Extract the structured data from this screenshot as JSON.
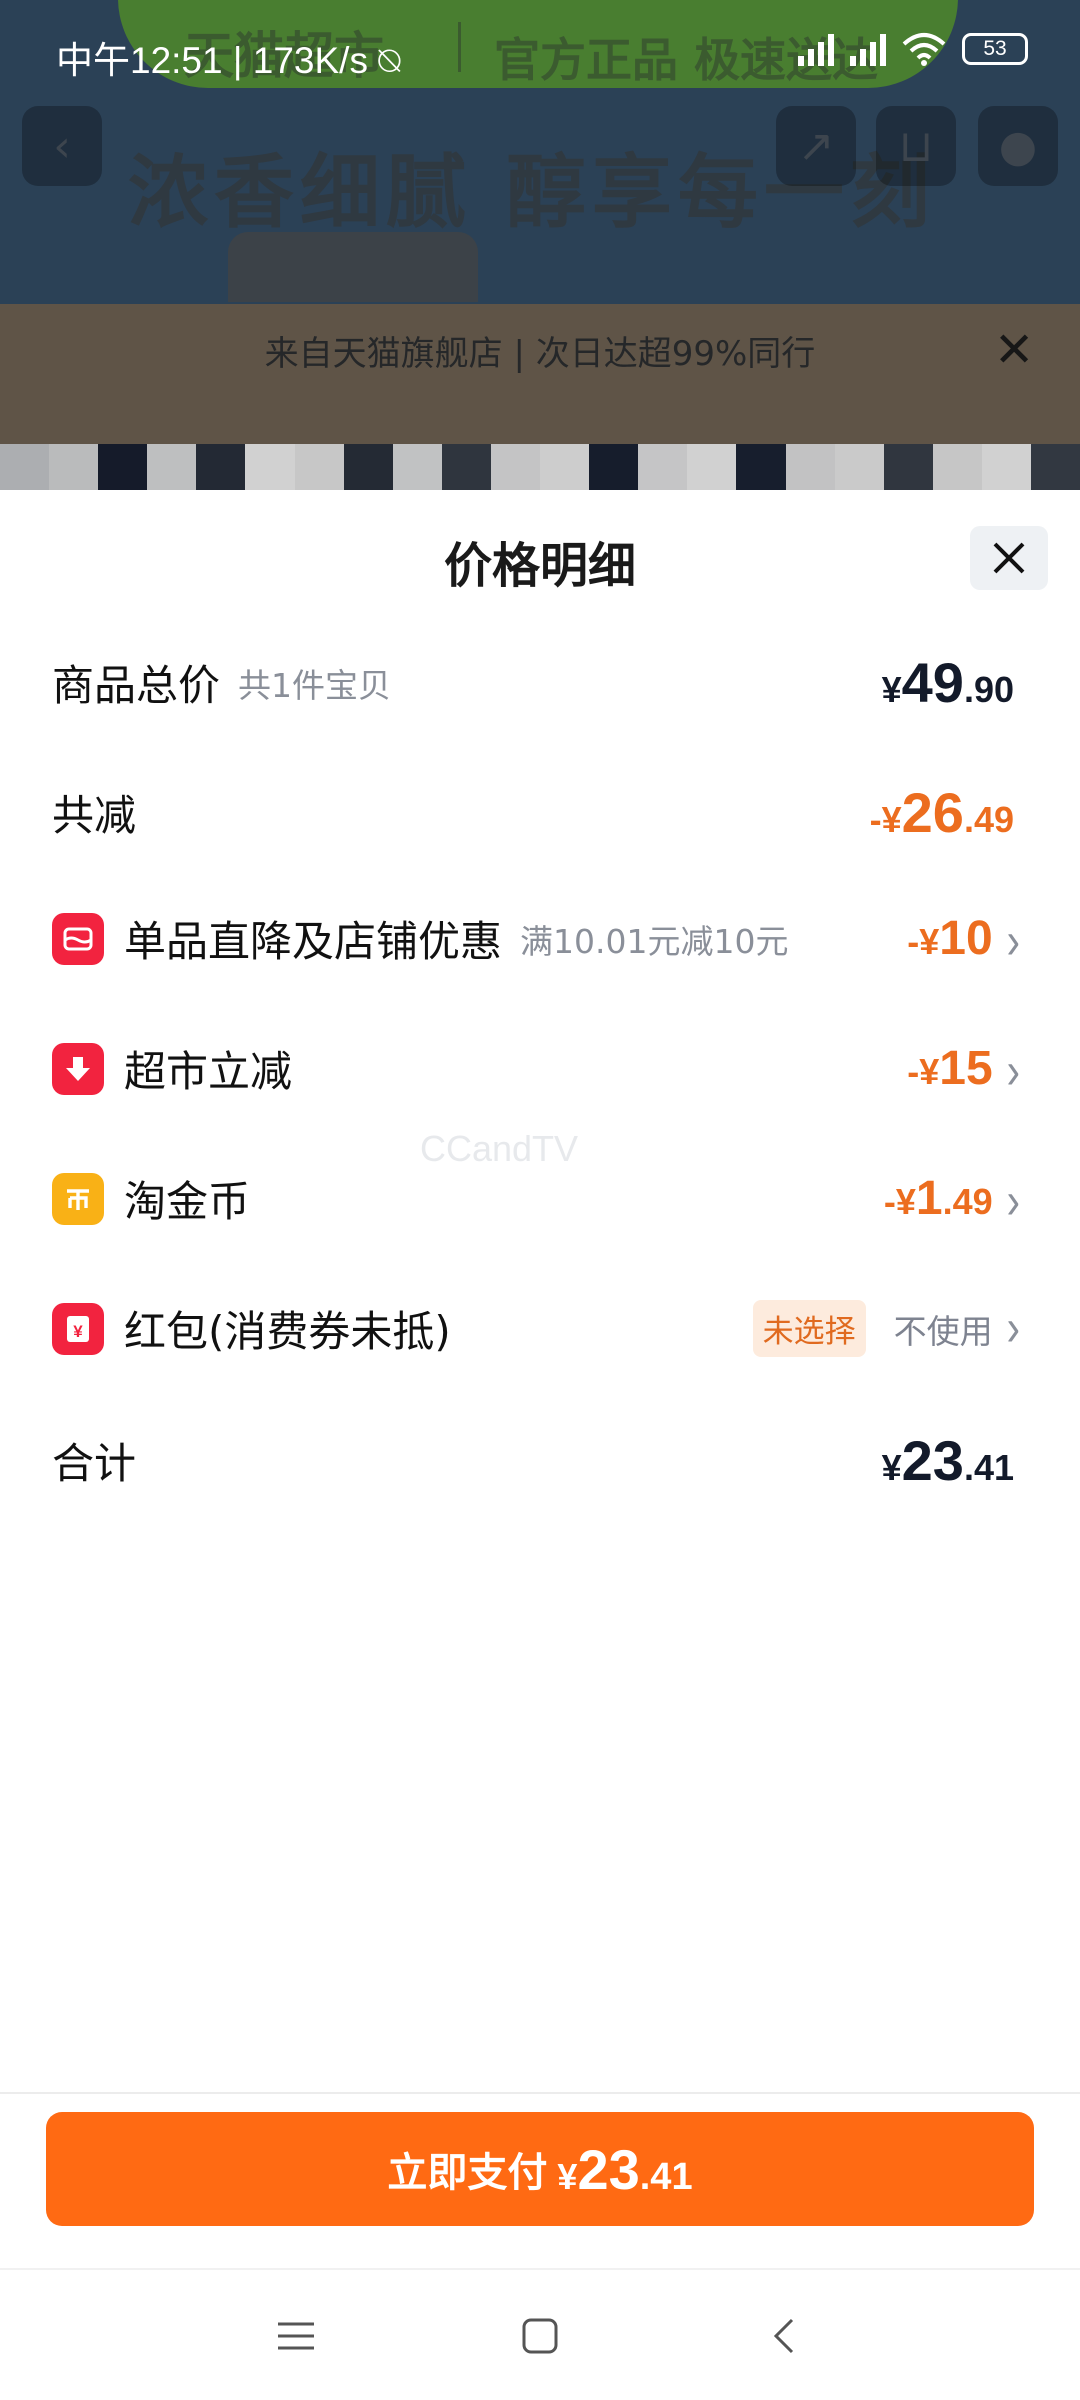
{
  "status_bar": {
    "time": "中午12:51",
    "speed": "173K/s",
    "battery": "53"
  },
  "background_page": {
    "banner_store": "天猫超市",
    "banner_tag": "官方正品 极速送达",
    "slogan": "浓香细腻 醇享每一刻",
    "strip_text": "来自天猫旗舰店 | 次日达超99%同行"
  },
  "sheet": {
    "title": "价格明细",
    "rows": {
      "total_label": "商品总价",
      "total_sub": "共1件宝贝",
      "total_price": {
        "cur": "¥",
        "int": "49",
        "dec": ".90"
      },
      "discount_label": "共减",
      "discount_price": {
        "cur": "-¥",
        "int": "26",
        "dec": ".49"
      },
      "item1_label": "单品直降及店铺优惠",
      "item1_sub": "满10.01元减10元",
      "item1_price": {
        "cur": "-¥",
        "int": "10"
      },
      "item2_label": "超市立减",
      "item2_price": {
        "cur": "-¥",
        "int": "15"
      },
      "item3_label": "淘金币",
      "item3_price": {
        "cur": "-¥",
        "int": "1",
        "dec": ".49"
      },
      "item4_label": "红包(消费券未抵)",
      "item4_badge": "未选择",
      "item4_value": "不使用",
      "sum_label": "合计",
      "sum_price": {
        "cur": "¥",
        "int": "23",
        "dec": ".41"
      }
    },
    "watermark": "CCandTV"
  },
  "footer": {
    "pay_label": "立即支付",
    "pay_price": {
      "cur": "¥",
      "int": "23",
      "dec": ".41"
    }
  },
  "icons": {
    "close": "close-icon",
    "shop_discount": "shop-discount-icon",
    "instant_discount": "down-arrow-icon",
    "taojinbi": "coin-icon",
    "red_packet": "red-packet-icon",
    "chevron": "chevron-right-icon"
  },
  "colors": {
    "accent_orange": "#ff6a13",
    "discount_orange": "#ec6d1f",
    "icon_red": "#f2233f",
    "icon_yellow": "#f9b116"
  }
}
